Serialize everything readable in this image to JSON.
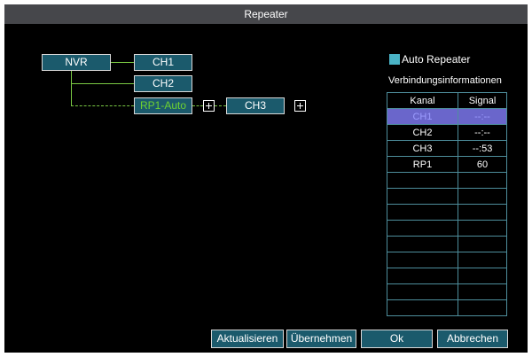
{
  "window": {
    "title": "Repeater"
  },
  "topology": {
    "nvr": "NVR",
    "ch1": "CH1",
    "ch2": "CH2",
    "rp1": "RP1-Auto",
    "ch3": "CH3"
  },
  "options": {
    "auto_repeater_label": "Auto Repeater",
    "auto_repeater_checked": true
  },
  "connection_info": {
    "title": "Verbindungsinformationen",
    "columns": [
      "Kanal",
      "Signal"
    ],
    "rows": [
      {
        "kanal": "CH1",
        "signal": "--:--"
      },
      {
        "kanal": "CH2",
        "signal": "--:--"
      },
      {
        "kanal": "CH3",
        "signal": "--:53"
      },
      {
        "kanal": "RP1",
        "signal": "60"
      },
      {
        "kanal": "",
        "signal": ""
      },
      {
        "kanal": "",
        "signal": ""
      },
      {
        "kanal": "",
        "signal": ""
      },
      {
        "kanal": "",
        "signal": ""
      },
      {
        "kanal": "",
        "signal": ""
      },
      {
        "kanal": "",
        "signal": ""
      },
      {
        "kanal": "",
        "signal": ""
      },
      {
        "kanal": "",
        "signal": ""
      },
      {
        "kanal": "",
        "signal": ""
      }
    ],
    "selected_row": 0
  },
  "buttons": {
    "refresh": "Aktualisieren",
    "apply": "Übernehmen",
    "ok": "Ok",
    "cancel": "Abbrechen"
  },
  "colors": {
    "accent": "#1b5a6c",
    "link_line": "#7ac943",
    "selection": "#6a66cb"
  }
}
